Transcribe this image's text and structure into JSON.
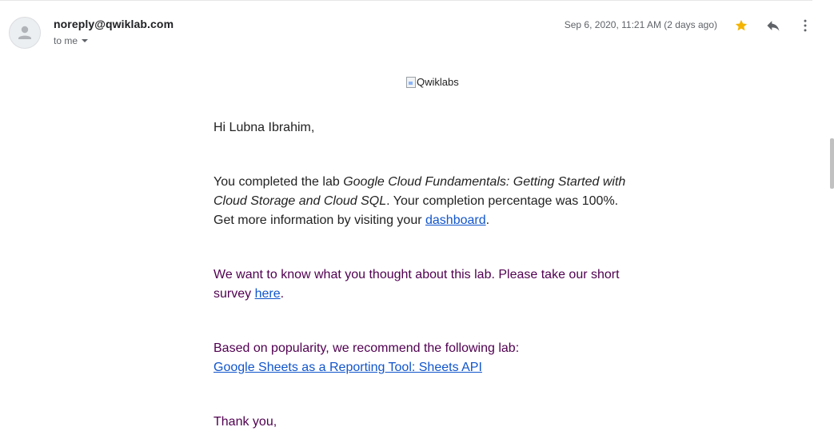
{
  "header": {
    "sender": "noreply@qwiklab.com",
    "to_label": "to me",
    "date": "Sep 6, 2020, 11:21 AM (2 days ago)",
    "icons": {
      "avatar": "person-icon",
      "to_dropdown": "caret-down-icon",
      "star": "star-icon",
      "reply": "reply-icon",
      "more": "more-vert-icon"
    },
    "star_color": "#f4b400"
  },
  "message": {
    "logo_alt": "Qwiklabs",
    "greeting": "Hi Lubna Ibrahim,",
    "para1": {
      "prefix": "You completed the lab ",
      "lab_name": "Google Cloud Fundamentals: Getting Started with Cloud Storage and Cloud SQL",
      "middle": ". Your completion percentage was 100%. Get more information by visiting your ",
      "link": "dashboard",
      "suffix": "."
    },
    "para2": {
      "prefix": "We want to know what you thought about this lab. Please take our short survey ",
      "link": "here",
      "suffix": "."
    },
    "para3": {
      "text": "Based on popularity, we recommend the following lab:",
      "link": "Google Sheets as a Reporting Tool: Sheets API"
    },
    "thanks": "Thank you,"
  },
  "colors": {
    "link": "#1155cc",
    "quoted_text": "#500050",
    "body_text": "#222222"
  }
}
